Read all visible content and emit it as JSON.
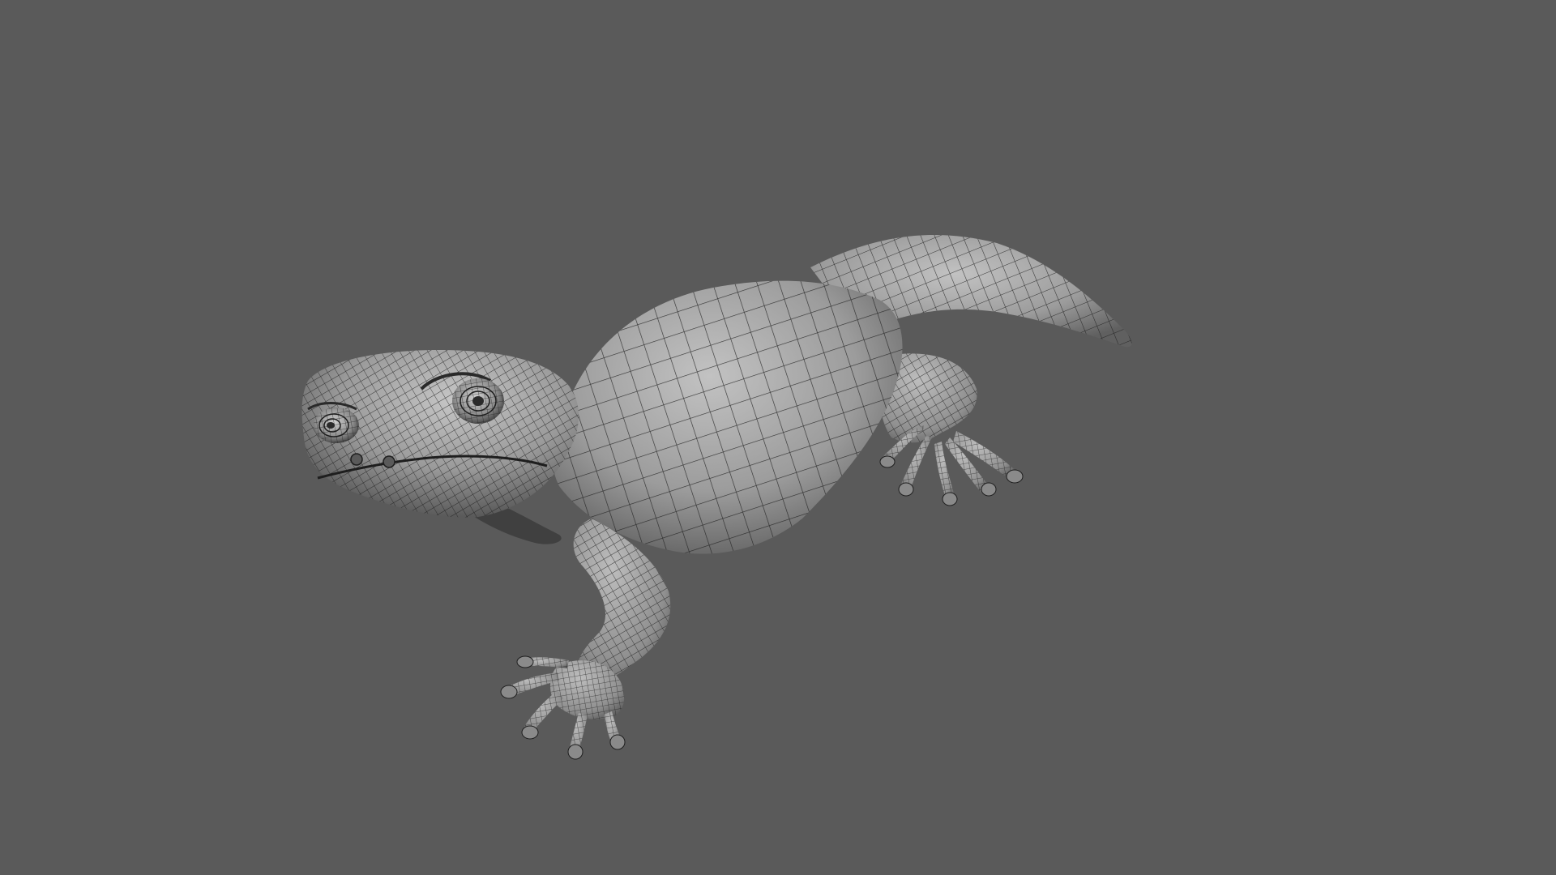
{
  "viewport": {
    "background_color": "#5a5a5a",
    "subject": "wireframe-gecko-model",
    "surface_color": "#9a9a9a",
    "wire_color": "#1e1e1e",
    "shadow_color": "#3a3a3a",
    "highlight_color": "#c4c4c4"
  }
}
